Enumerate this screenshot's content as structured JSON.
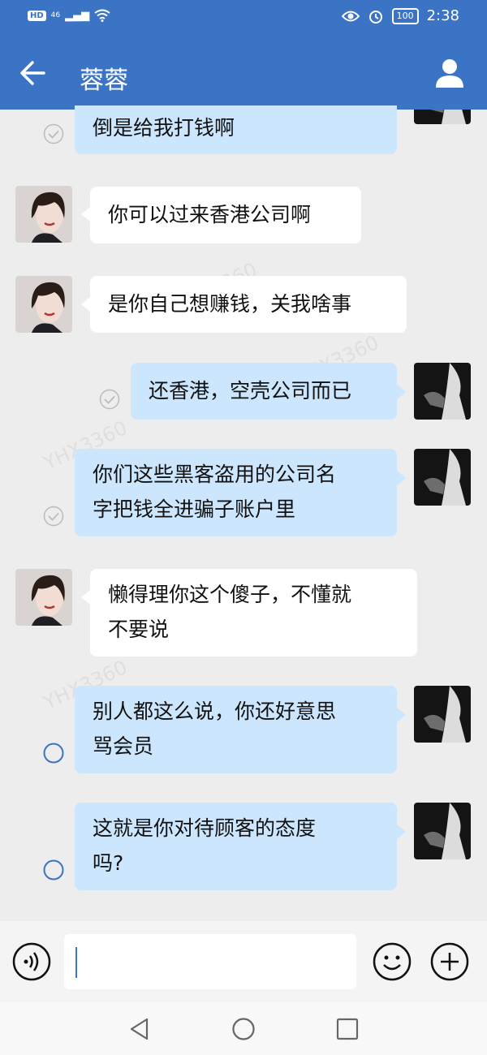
{
  "status_bar": {
    "hd": "HD",
    "network": "46",
    "time": "2:38",
    "battery": "100"
  },
  "header": {
    "title": "蓉蓉"
  },
  "messages": [
    {
      "side": "right",
      "text": "倒是给我打钱啊",
      "status": "read"
    },
    {
      "side": "left",
      "text": "你可以过来香港公司啊"
    },
    {
      "side": "left",
      "text": "是你自己想赚钱，关我啥事"
    },
    {
      "side": "right",
      "text": "还香港，空壳公司而已",
      "status": "read"
    },
    {
      "side": "right",
      "line1": "你们这些黑客盗用的公司名",
      "line2": "字把钱全进骗子账户里",
      "status": "read"
    },
    {
      "side": "left",
      "line1": "懒得理你这个傻子，不懂就",
      "line2": "不要说"
    },
    {
      "side": "right",
      "line1": "别人都这么说，你还好意思",
      "line2": "骂会员",
      "status": "unread"
    },
    {
      "side": "right",
      "line1": "这就是你对待顾客的态度",
      "line2": "吗?",
      "status": "unread"
    }
  ],
  "watermark": "YHX3360",
  "input": {
    "value": ""
  },
  "icons": {
    "back": "arrow-left-icon",
    "profile": "person-icon",
    "voice": "voice-icon",
    "emoji": "emoji-icon",
    "plus": "plus-icon",
    "nav_back": "triangle-back-icon",
    "nav_home": "circle-home-icon",
    "nav_recent": "square-recent-icon"
  },
  "colors": {
    "header": "#3b74c5",
    "bubble_right": "#cce6fd",
    "bubble_left": "#ffffff",
    "background": "#ededed"
  }
}
